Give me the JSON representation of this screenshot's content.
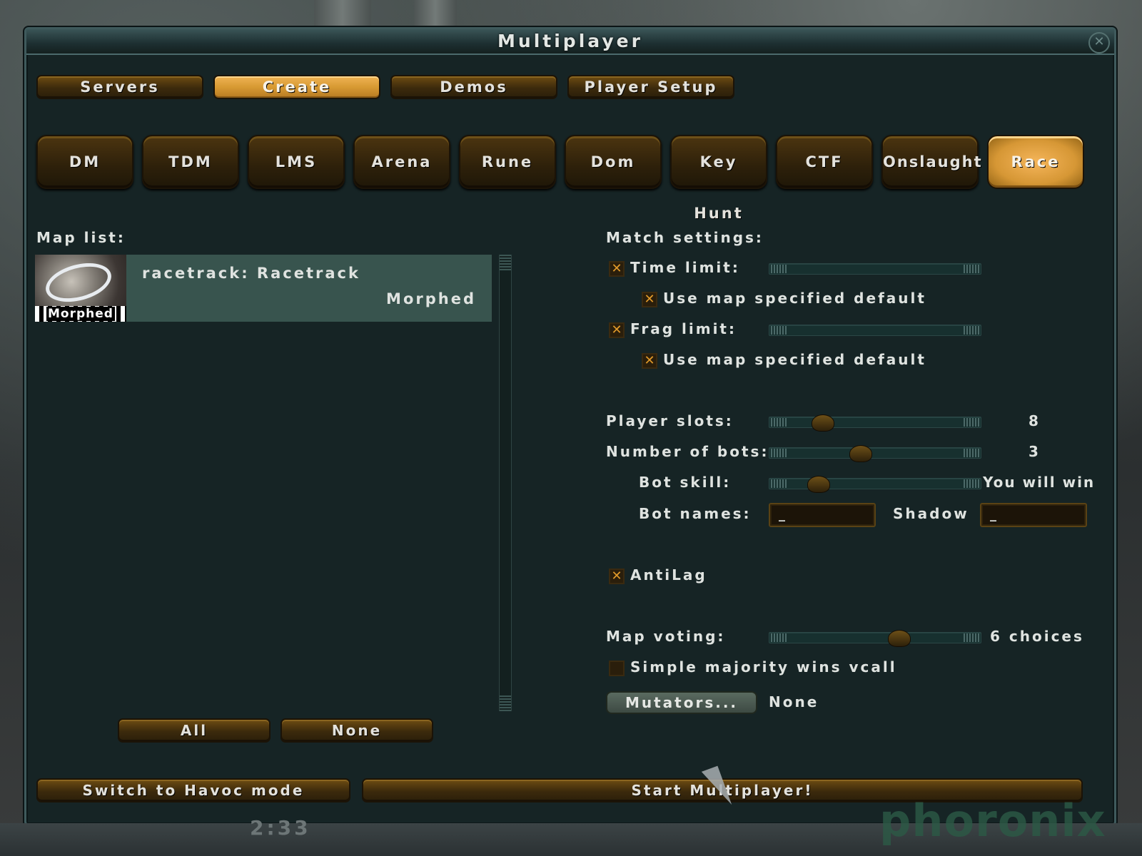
{
  "window": {
    "title": "Multiplayer",
    "close": "✕"
  },
  "tabs": [
    {
      "label": "Servers"
    },
    {
      "label": "Create"
    },
    {
      "label": "Demos"
    },
    {
      "label": "Player Setup"
    }
  ],
  "active_tab": "Create",
  "gametypes": [
    {
      "label": "DM"
    },
    {
      "label": "TDM"
    },
    {
      "label": "LMS"
    },
    {
      "label": "Arena"
    },
    {
      "label": "Rune"
    },
    {
      "label": "Dom"
    },
    {
      "label": "Key Hunt"
    },
    {
      "label": "CTF"
    },
    {
      "label": "Onslaught"
    },
    {
      "label": "Race"
    }
  ],
  "active_gametype": "Race",
  "maplist": {
    "label": "Map list:",
    "items": [
      {
        "name": "racetrack: Racetrack",
        "author": "Morphed",
        "thumb_text": "Morphed"
      }
    ],
    "all_button": "All",
    "none_button": "None"
  },
  "match": {
    "label": "Match settings:",
    "time_limit": {
      "label": "Time limit:",
      "checked": true,
      "mark": "✕"
    },
    "time_default": {
      "label": "Use map specified default",
      "checked": true,
      "mark": "✕"
    },
    "frag_limit": {
      "label": "Frag limit:",
      "checked": true,
      "mark": "✕"
    },
    "frag_default": {
      "label": "Use map specified default",
      "checked": true,
      "mark": "✕"
    },
    "player_slots": {
      "label": "Player slots:",
      "value": "8",
      "level": 0.25
    },
    "bots": {
      "label": "Number of bots:",
      "value": "3",
      "level": 0.43
    },
    "bot_skill": {
      "label": "Bot skill:",
      "value": "You will win",
      "level": 0.23
    },
    "bot_names": {
      "label": "Bot names:",
      "field1": "_",
      "field2_label": "Shadow",
      "field2": "_"
    },
    "antilag": {
      "label": "AntiLag",
      "checked": true,
      "mark": "✕"
    },
    "map_voting": {
      "label": "Map voting:",
      "value": "6 choices",
      "level": 0.61
    },
    "simple_majority": {
      "label": "Simple majority wins vcall",
      "checked": false,
      "mark": ""
    },
    "mutators_button": "Mutators...",
    "mutators_value": "None"
  },
  "bottom": {
    "havoc_button": "Switch to Havoc mode",
    "start_button": "Start Multiplayer!"
  },
  "hud": {
    "clock": "2:33",
    "watermark": "phoronix"
  },
  "colors": {
    "panel": "#162425",
    "button": "#3c2a0c",
    "button_active": "#d79a33",
    "selection": "#38544e",
    "check": "#e19a2a"
  }
}
